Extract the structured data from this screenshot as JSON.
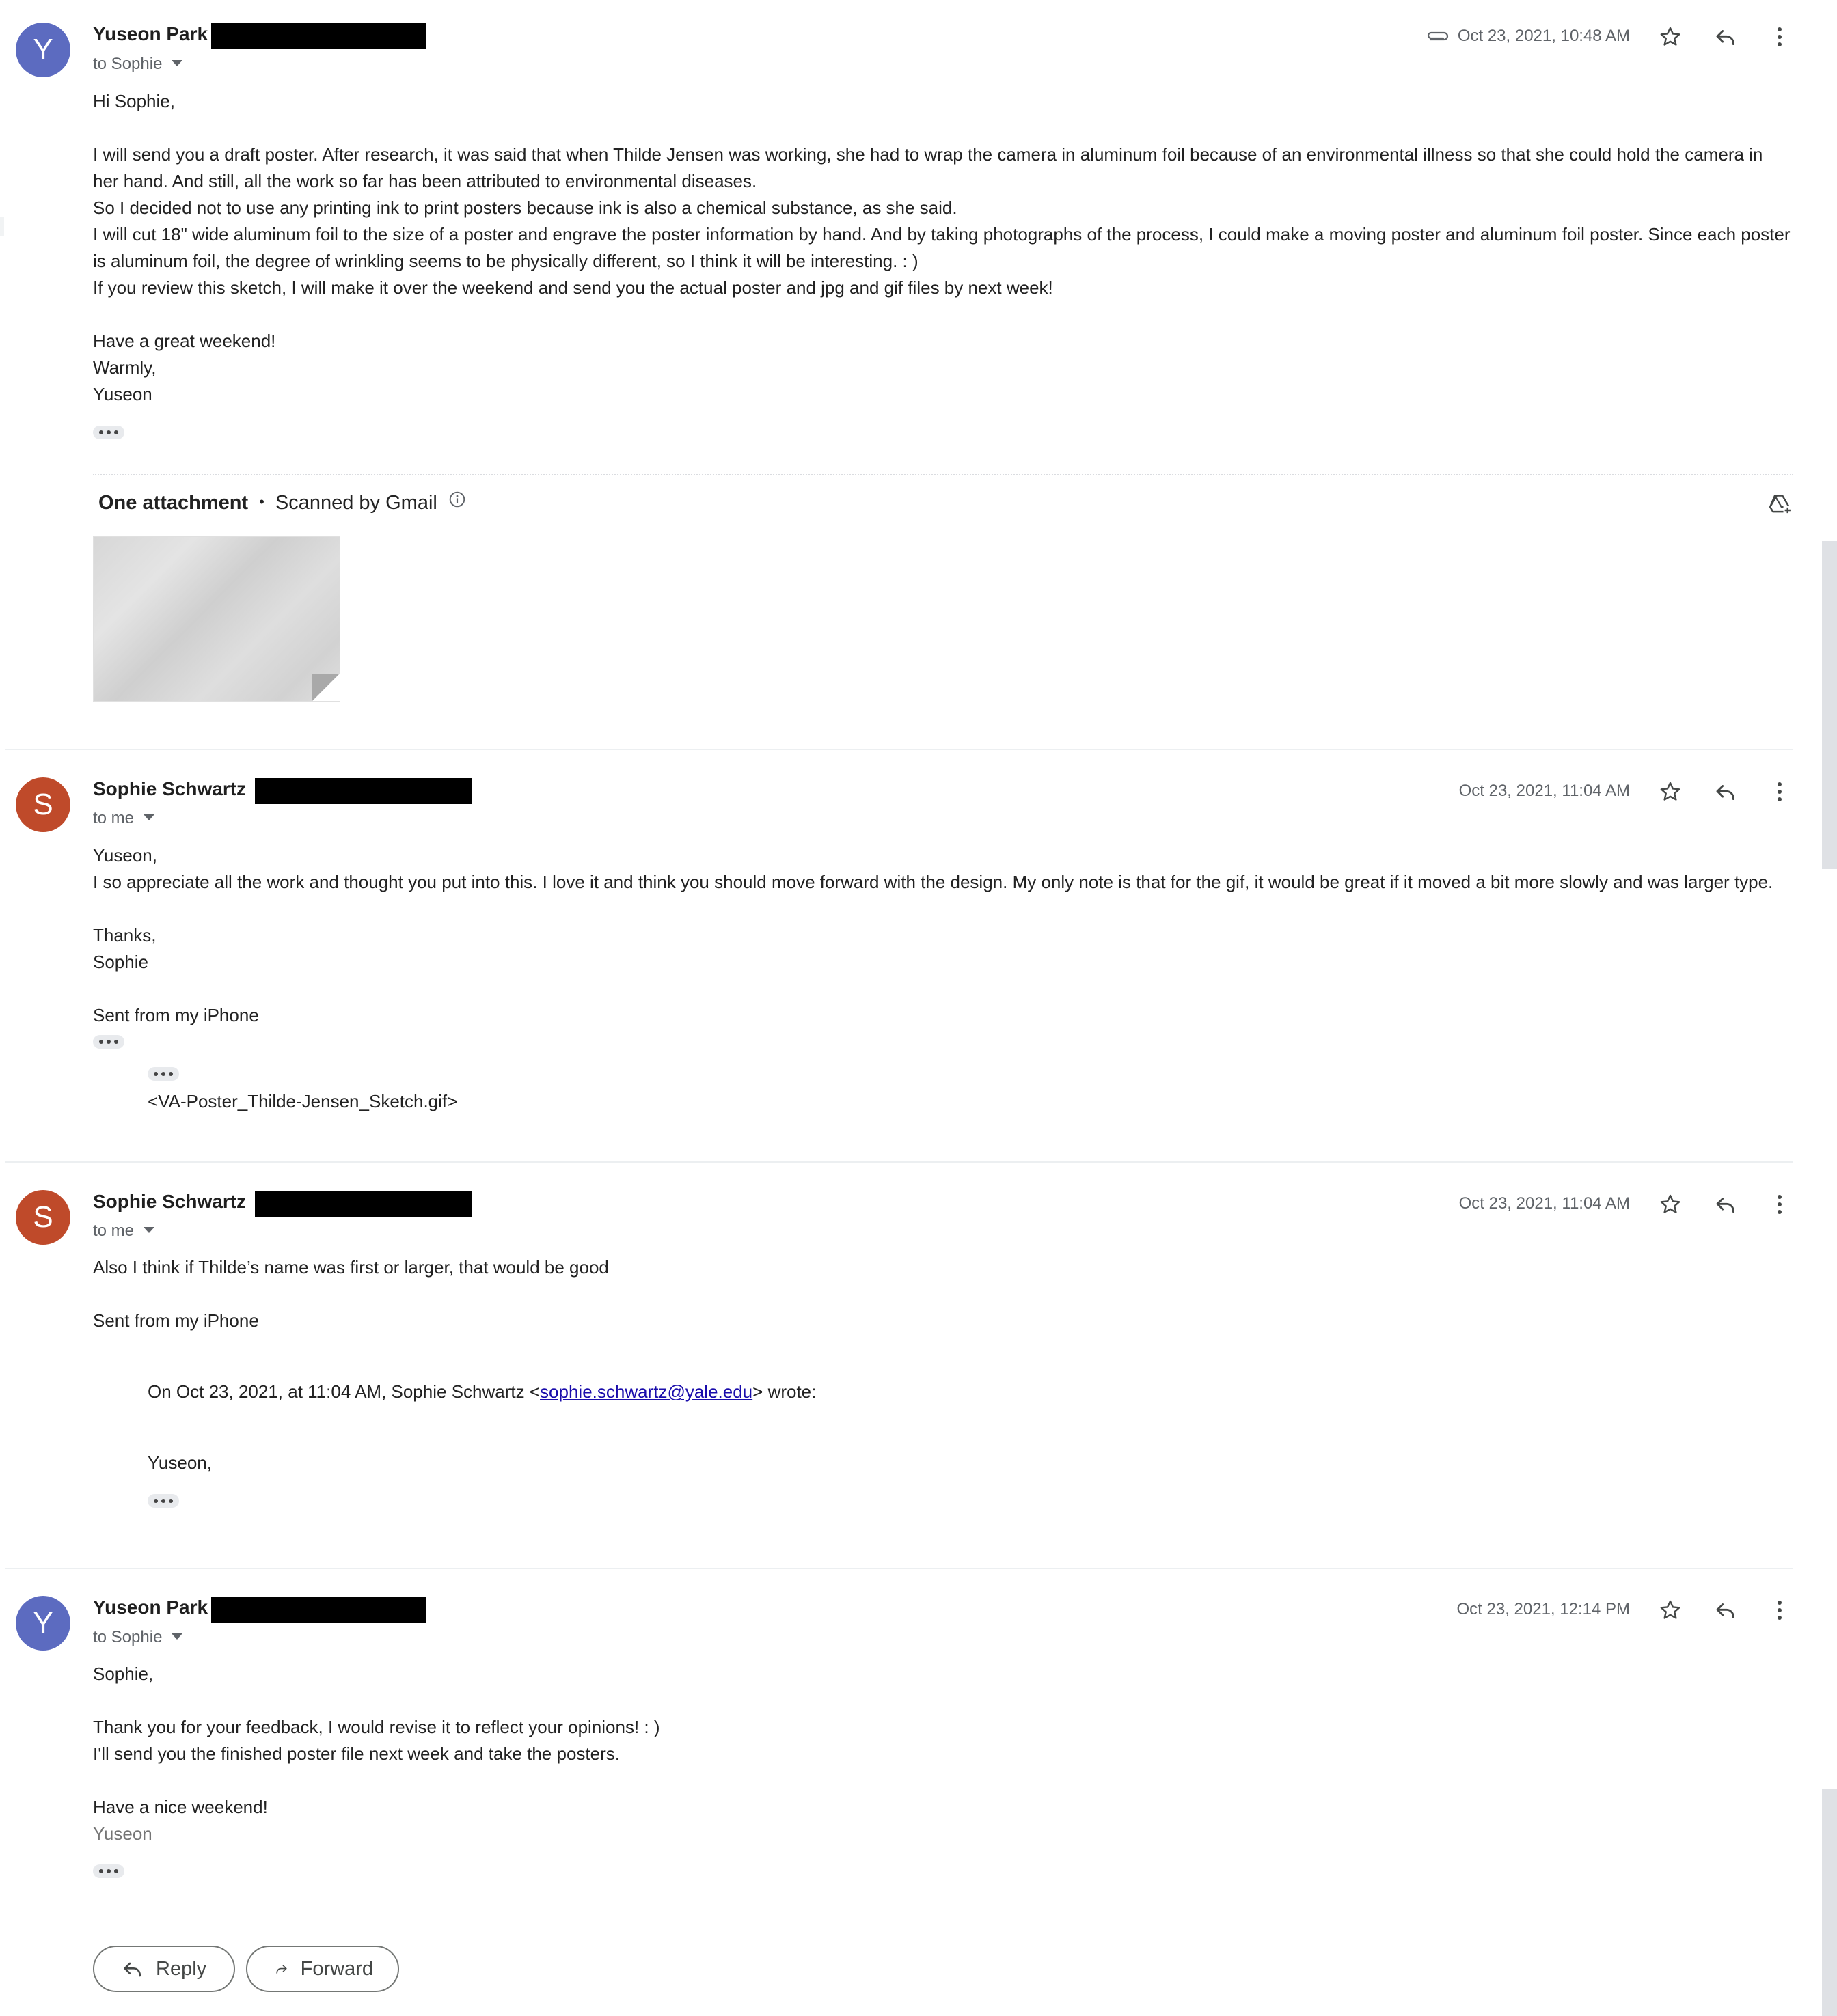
{
  "messages": [
    {
      "avatar_letter": "Y",
      "avatar_color": "#5c6bc0",
      "sender": "Yuseon Park",
      "recipient": "to Sophie",
      "date": "Oct 23, 2021, 10:48 AM",
      "has_attachment": true,
      "body": [
        "Hi Sophie,",
        "",
        "I will send you a draft poster. After research, it was said that when Thilde Jensen was working, she had to wrap the camera in aluminum foil because of an environmental illness so that she could hold the camera in",
        "her hand. And still, all the work so far has been attributed to environmental diseases.",
        "So I decided not to use any printing ink to print posters because ink is also a chemical substance, as she said.",
        "I will cut 18\" wide aluminum foil to the size of a poster and engrave the poster information by hand. And by taking photographs of the process, I could make a moving poster and aluminum foil poster. Since each poster",
        "is aluminum foil, the degree of wrinkling seems to be physically different, so I think it will be interesting. : )",
        "If you review this sketch, I will make it over the weekend and send you the actual poster and jpg and gif files by next week!",
        "",
        "Have a great weekend!",
        "Warmly,",
        "Yuseon"
      ]
    },
    {
      "avatar_letter": "S",
      "avatar_color": "#bf4a2a",
      "sender": "Sophie Schwartz",
      "recipient": "to me",
      "date": "Oct 23, 2021, 11:04 AM",
      "body": [
        "Yuseon,",
        "I so appreciate all the work and thought you put into this. I love it and think you should move forward with the design. My only note is that for the gif, it would be great if it moved a bit more slowly and was larger type.",
        "",
        "Thanks,",
        "Sophie",
        "",
        "Sent from my iPhone"
      ],
      "quoted_attachment": "<VA-Poster_Thilde-Jensen_Sketch.gif>"
    },
    {
      "avatar_letter": "S",
      "avatar_color": "#bf4a2a",
      "sender": "Sophie Schwartz",
      "recipient": "to me",
      "date": "Oct 23, 2021, 11:04 AM",
      "body": [
        "Also I think if Thilde’s name was first or larger, that would be good",
        "",
        "Sent from my iPhone"
      ],
      "quote_intro_before": "On Oct 23, 2021, at 11:04 AM, Sophie Schwartz <",
      "quote_email": "sophie.schwartz@yale.edu",
      "quote_intro_after": "> wrote:",
      "quote_body": "Yuseon,"
    },
    {
      "avatar_letter": "Y",
      "avatar_color": "#5c6bc0",
      "sender": "Yuseon Park",
      "recipient": "to Sophie",
      "date": "Oct 23, 2021, 12:14 PM",
      "body": [
        "Sophie,",
        "",
        "Thank you for your feedback, I would revise it to reflect your opinions! : )",
        "I'll send you the finished poster file next week and take the posters.",
        "",
        "Have a nice weekend!"
      ],
      "signature": "Yuseon"
    }
  ],
  "attachment": {
    "heading": "One attachment",
    "scan_status": "Scanned by Gmail"
  },
  "actions": {
    "reply_label": "Reply",
    "forward_label": "Forward"
  }
}
